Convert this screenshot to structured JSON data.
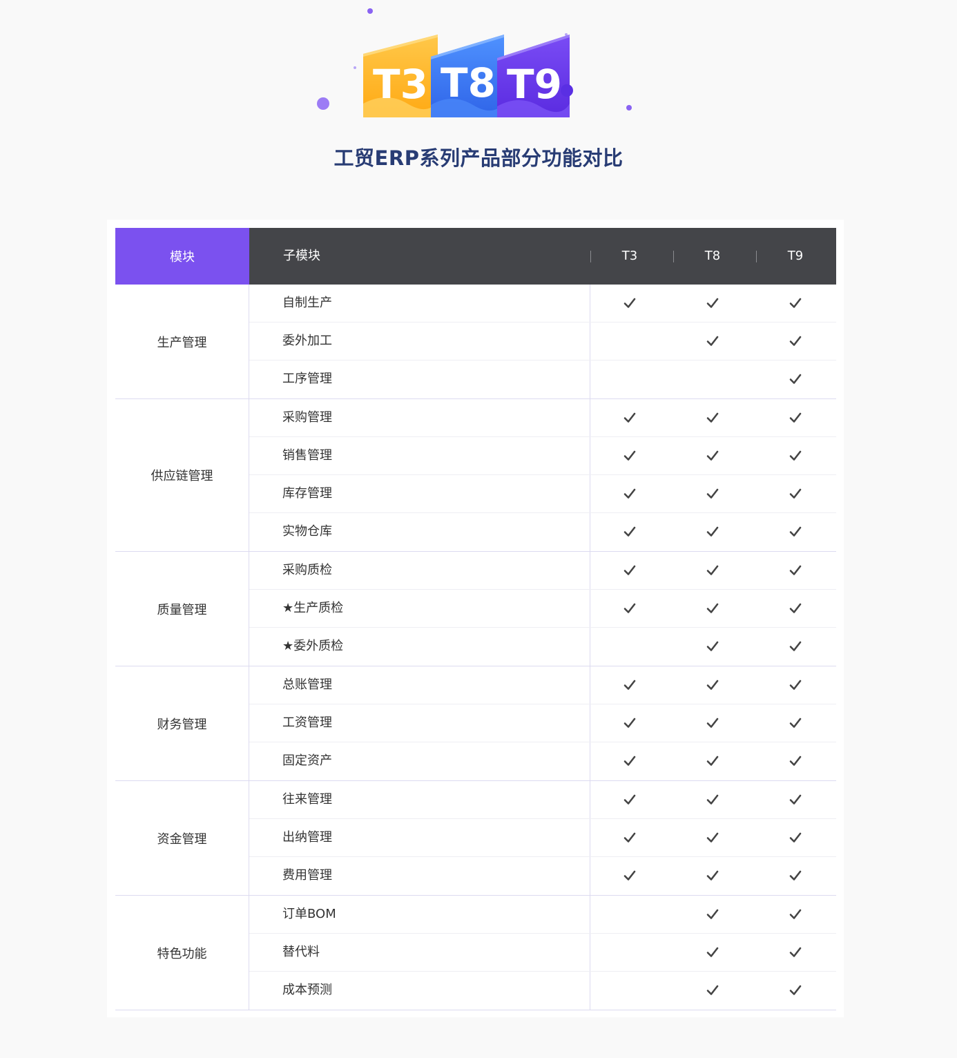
{
  "page": {
    "title": "工贸ERP系列产品部分功能对比"
  },
  "logo": {
    "badges": [
      "T3",
      "T8",
      "T9"
    ],
    "colors": [
      "#ffb51f",
      "#3f7cf2",
      "#6a3ef0"
    ]
  },
  "table": {
    "header": {
      "module": "模块",
      "submodule": "子模块",
      "versions": [
        "T3",
        "T8",
        "T9"
      ]
    },
    "groups": [
      {
        "label": "生产管理",
        "rows": [
          {
            "label": "自制生产",
            "marks": [
              true,
              true,
              true
            ]
          },
          {
            "label": "委外加工",
            "marks": [
              false,
              true,
              true
            ]
          },
          {
            "label": "工序管理",
            "marks": [
              false,
              false,
              true
            ]
          }
        ]
      },
      {
        "label": "供应链管理",
        "rows": [
          {
            "label": "采购管理",
            "marks": [
              true,
              true,
              true
            ]
          },
          {
            "label": "销售管理",
            "marks": [
              true,
              true,
              true
            ]
          },
          {
            "label": "库存管理",
            "marks": [
              true,
              true,
              true
            ]
          },
          {
            "label": "实物仓库",
            "marks": [
              true,
              true,
              true
            ]
          }
        ]
      },
      {
        "label": "质量管理",
        "rows": [
          {
            "label": "采购质检",
            "marks": [
              true,
              true,
              true
            ]
          },
          {
            "label": "★生产质检",
            "marks": [
              true,
              true,
              true
            ]
          },
          {
            "label": "★委外质检",
            "marks": [
              false,
              true,
              true
            ]
          }
        ]
      },
      {
        "label": "财务管理",
        "rows": [
          {
            "label": "总账管理",
            "marks": [
              true,
              true,
              true
            ]
          },
          {
            "label": "工资管理",
            "marks": [
              true,
              true,
              true
            ]
          },
          {
            "label": "固定资产",
            "marks": [
              true,
              true,
              true
            ]
          }
        ]
      },
      {
        "label": "资金管理",
        "rows": [
          {
            "label": "往来管理",
            "marks": [
              true,
              true,
              true
            ]
          },
          {
            "label": "出纳管理",
            "marks": [
              true,
              true,
              true
            ]
          },
          {
            "label": "费用管理",
            "marks": [
              true,
              true,
              true
            ]
          }
        ]
      },
      {
        "label": "特色功能",
        "rows": [
          {
            "label": "订单BOM",
            "marks": [
              false,
              true,
              true
            ]
          },
          {
            "label": "替代料",
            "marks": [
              false,
              true,
              true
            ]
          },
          {
            "label": "成本预测",
            "marks": [
              false,
              true,
              true
            ]
          }
        ]
      }
    ]
  },
  "colors": {
    "accent": "#7b51ef",
    "header_bg": "#444549",
    "title": "#283c74",
    "check": "#444444"
  }
}
